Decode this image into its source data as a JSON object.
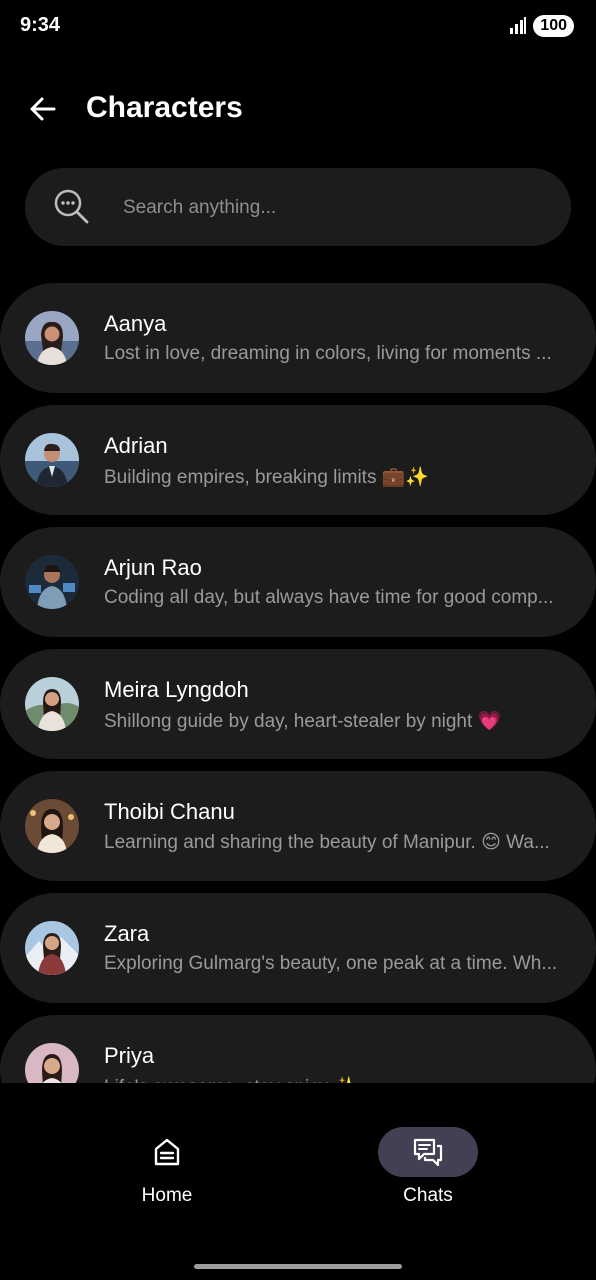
{
  "status_bar": {
    "time": "9:34",
    "battery": "100"
  },
  "header": {
    "title": "Characters"
  },
  "search": {
    "placeholder": "Search anything..."
  },
  "characters": [
    {
      "name": "Aanya",
      "desc": "Lost in love, dreaming in colors, living for moments ..."
    },
    {
      "name": "Adrian",
      "desc": "Building empires, breaking limits 💼✨"
    },
    {
      "name": "Arjun Rao",
      "desc": "Coding all day, but always have time for good comp..."
    },
    {
      "name": "Meira Lyngdoh",
      "desc": "Shillong guide by day, heart-stealer by night 💗"
    },
    {
      "name": "Thoibi Chanu",
      "desc": "Learning and sharing the beauty of Manipur. 😊 Wa..."
    },
    {
      "name": "Zara",
      "desc": "Exploring Gulmarg's beauty, one peak at a time. Wh..."
    },
    {
      "name": "Priya",
      "desc": "Life's awesome, stay spicy ✨"
    }
  ],
  "nav": {
    "home_label": "Home",
    "chats_label": "Chats",
    "active": "Chats"
  },
  "colors": {
    "background": "#000000",
    "card": "#1c1c1c",
    "active_nav": "#443f52",
    "secondary_text": "#9a9a9a"
  }
}
